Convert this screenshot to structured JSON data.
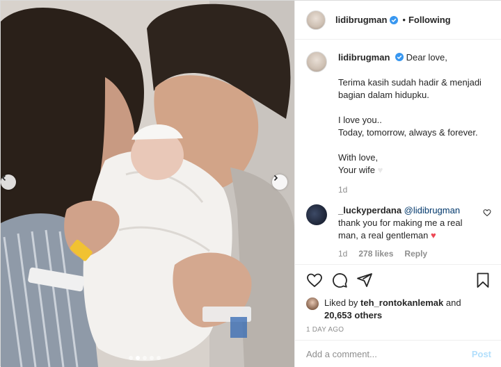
{
  "header": {
    "username": "lidibrugman",
    "separator": "•",
    "follow_status": "Following"
  },
  "caption": {
    "username": "lidibrugman",
    "lines": [
      "Dear love,",
      "",
      "Terima kasih sudah hadir & menjadi bagian dalam hidupku.",
      "",
      "I love you..",
      "Today, tomorrow, always & forever.",
      "",
      "With love,",
      "Your wife"
    ],
    "age": "1d"
  },
  "comment": {
    "username": "_luckyperdana",
    "mention": "@lidibrugman",
    "text": "thank you for making me a real man, a real gentleman",
    "emoji": "♥",
    "age": "1d",
    "likes": "278 likes",
    "reply": "Reply"
  },
  "actions": {
    "liked_by_prefix": "Liked by",
    "liked_by_user": "teh_rontokanlemak",
    "liked_by_and": "and",
    "others": "20,653 others",
    "timestamp": "1 DAY AGO"
  },
  "add_comment": {
    "placeholder": "Add a comment...",
    "post_label": "Post"
  },
  "icons": {
    "like": "heart-icon",
    "comment": "comment-icon",
    "share": "share-icon",
    "save": "bookmark-icon",
    "verified": "verified-badge-icon",
    "prev": "chevron-left-icon",
    "next": "chevron-right-icon"
  },
  "colors": {
    "verified": "#3897f0",
    "mention": "#00376b",
    "heart": "#ed4956",
    "post_button": "#b2dffc",
    "muted": "#8e8e8e"
  },
  "carousel": {
    "total_slides": 5,
    "active_slide": 2
  }
}
